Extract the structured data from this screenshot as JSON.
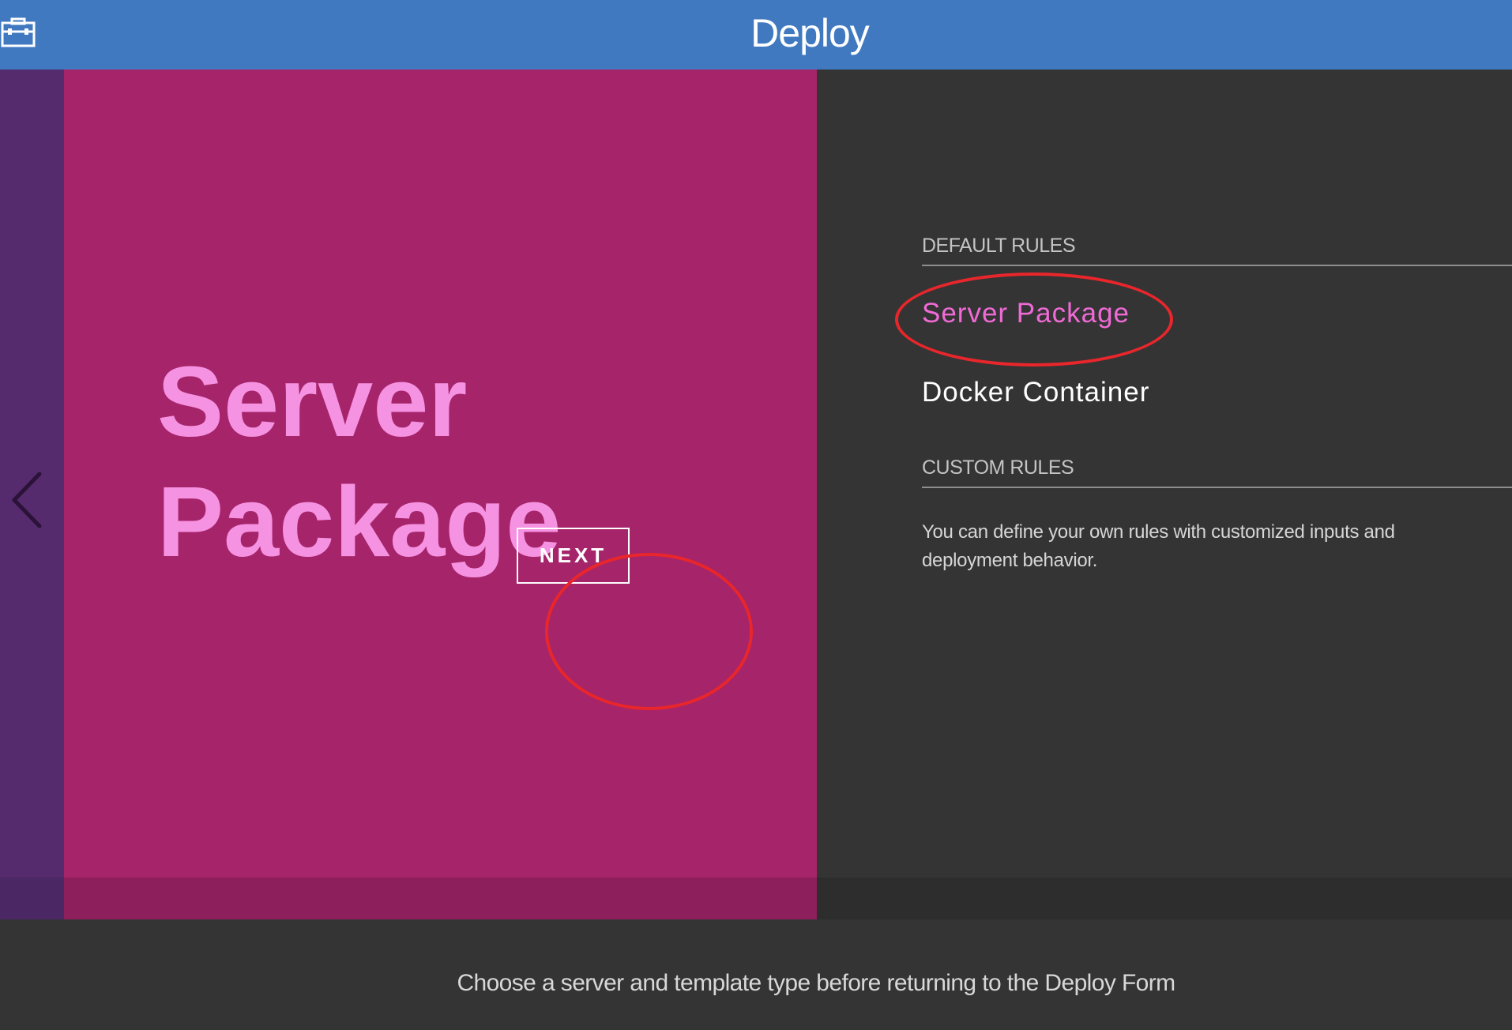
{
  "header": {
    "title": "Deploy",
    "icon": "toolbox-icon",
    "background": "#4079c0"
  },
  "hero": {
    "title_line1": "Server",
    "title_line2": "Package",
    "next_label": "NEXT",
    "background": "#a6246a",
    "title_color": "#f692e2"
  },
  "nav": {
    "back_icon": "chevron-left-icon"
  },
  "rules": {
    "default_header": "DEFAULT RULES",
    "items": [
      {
        "label": "Server Package",
        "selected": true
      },
      {
        "label": "Docker Container",
        "selected": false
      }
    ],
    "custom_header": "CUSTOM RULES",
    "custom_description": "You can define your own rules with customized inputs and deployment behavior."
  },
  "footer": {
    "text": "Choose a server and template type before returning to the Deploy Form"
  },
  "annotations": {
    "highlight_color": "#e8262b"
  }
}
